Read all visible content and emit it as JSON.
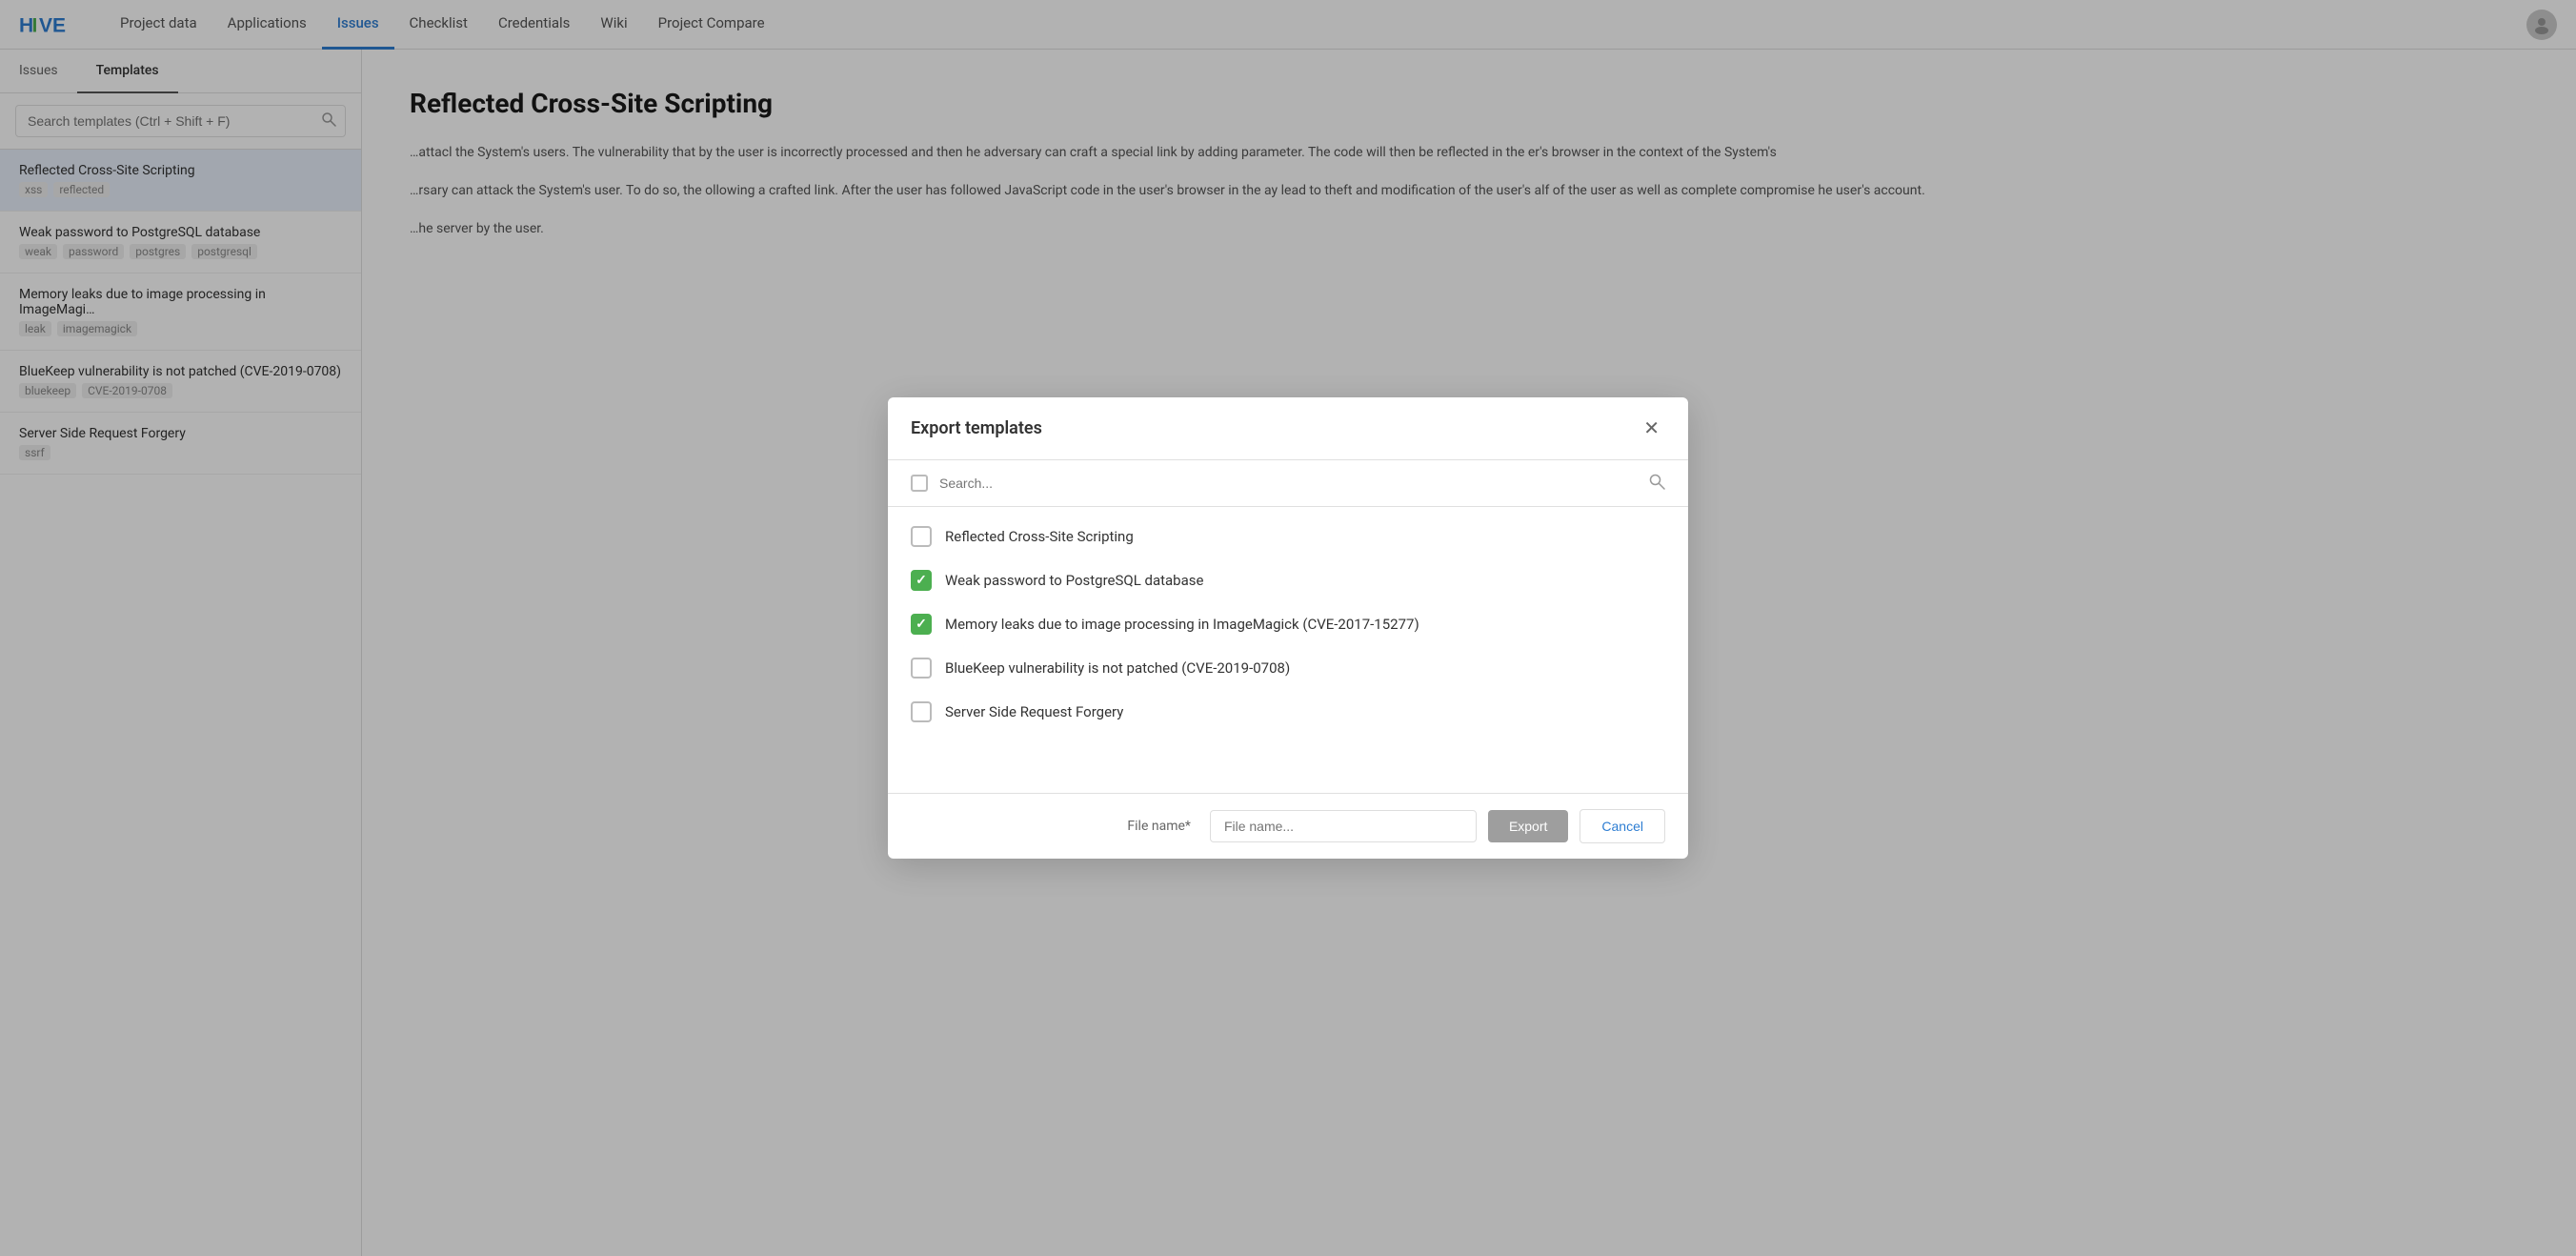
{
  "nav": {
    "logo_text": "HIVE",
    "links": [
      {
        "label": "Project data",
        "active": false
      },
      {
        "label": "Applications",
        "active": false
      },
      {
        "label": "Issues",
        "active": true
      },
      {
        "label": "Checklist",
        "active": false
      },
      {
        "label": "Credentials",
        "active": false
      },
      {
        "label": "Wiki",
        "active": false
      },
      {
        "label": "Project Compare",
        "active": false
      }
    ]
  },
  "left_panel": {
    "tabs": [
      {
        "label": "Issues",
        "active": false
      },
      {
        "label": "Templates",
        "active": true
      }
    ],
    "search_placeholder": "Search templates (Ctrl + Shift + F)",
    "templates": [
      {
        "title": "Reflected Cross-Site Scripting",
        "tags": [
          "xss",
          "reflected"
        ],
        "selected": true
      },
      {
        "title": "Weak password to PostgreSQL database",
        "tags": [
          "weak",
          "password",
          "postgres",
          "postgresql"
        ],
        "selected": false
      },
      {
        "title": "Memory leaks due to image processing in ImageMagi…",
        "tags": [
          "leak",
          "imagemagick"
        ],
        "selected": false
      },
      {
        "title": "BlueKeep vulnerability is not patched (CVE-2019-0708)",
        "tags": [
          "bluekeep",
          "CVE-2019-0708"
        ],
        "selected": false
      },
      {
        "title": "Server Side Request Forgery",
        "tags": [
          "ssrf"
        ],
        "selected": false
      }
    ]
  },
  "right_panel": {
    "title": "Reflected Cross-Site Scripting",
    "text_parts": [
      "attacl the System's users. The vulnerability that by the user is incorrectly processed and then he adversary can craft a special link by adding parameter. The code will then be reflected in the er's browser in the context of the System's",
      "rsary can attack the System's user. To do so, the ollowing a crafted link. After the user has followed JavaScript code in the user's browser in the ay lead to theft and modification of the user's alf of the user as well as complete compromise he user's account.",
      "he server by the user."
    ]
  },
  "modal": {
    "title": "Export templates",
    "search_placeholder": "Search...",
    "items": [
      {
        "label": "Reflected Cross-Site Scripting",
        "checked": false
      },
      {
        "label": "Weak password to PostgreSQL database",
        "checked": true
      },
      {
        "label": "Memory leaks due to image processing in ImageMagick (CVE-2017-15277)",
        "checked": true
      },
      {
        "label": "BlueKeep vulnerability is not patched (CVE-2019-0708)",
        "checked": false
      },
      {
        "label": "Server Side Request Forgery",
        "checked": false
      }
    ],
    "file_name_label": "File name*",
    "file_name_placeholder": "File name...",
    "export_button": "Export",
    "cancel_button": "Cancel"
  }
}
